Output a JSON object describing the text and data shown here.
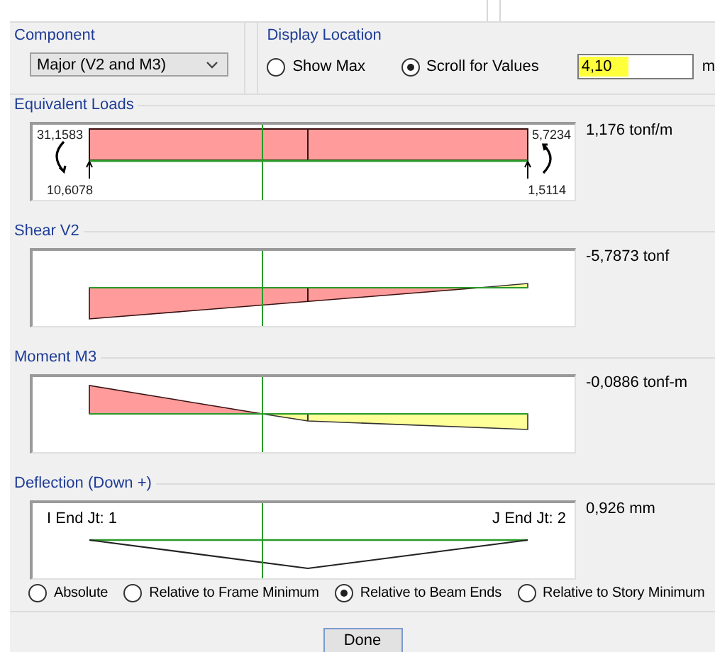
{
  "component": {
    "label": "Component",
    "value": "Major (V2 and M3)"
  },
  "display_location": {
    "label": "Display Location",
    "options": [
      {
        "label": "Show Max",
        "selected": false
      },
      {
        "label": "Scroll for Values",
        "selected": true
      }
    ],
    "field": {
      "value": "4,10",
      "highlighted": true
    },
    "unit": "m"
  },
  "sections": [
    {
      "kind": "loads",
      "title": "Equivalent Loads",
      "value": "1,176 tonf/m",
      "end_values": [
        "31,1583",
        "10,6078",
        "5,7234",
        "1,5114"
      ]
    },
    {
      "kind": "shear",
      "title": "Shear V2",
      "value": "-5,7873 tonf"
    },
    {
      "kind": "moment",
      "title": "Moment M3",
      "value": "-0,0886 tonf-m"
    },
    {
      "kind": "deflection",
      "title": "Deflection (Down +)",
      "value": "0,926 mm",
      "end_labels": [
        "I End Jt: 1",
        "J End Jt: 2"
      ]
    }
  ],
  "deflection_reference": [
    {
      "label": "Absolute",
      "selected": false
    },
    {
      "label": "Relative to Frame Minimum",
      "selected": false
    },
    {
      "label": "Relative to Beam Ends",
      "selected": true
    },
    {
      "label": "Relative to Story Minimum",
      "selected": false
    }
  ],
  "done_button": "Done"
}
